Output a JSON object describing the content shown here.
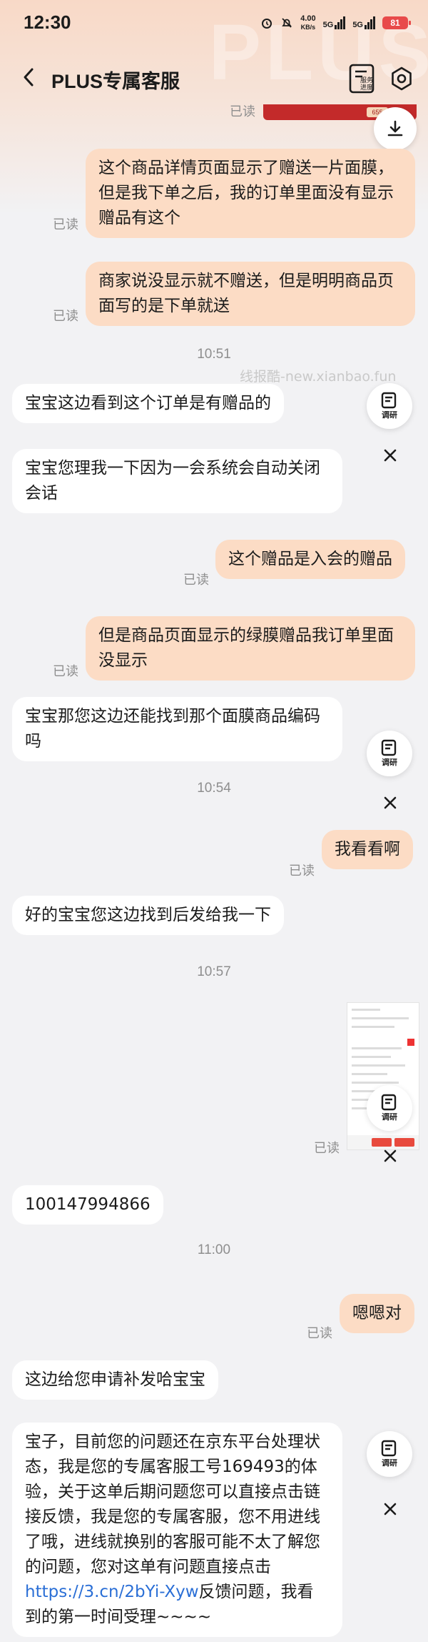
{
  "status_bar": {
    "time": "12:30",
    "net_speed": "4.00",
    "net_unit": "KB/s",
    "sig1": "5G",
    "sig2": "5G",
    "battery": "81"
  },
  "header": {
    "title": "PLUS专属客服",
    "service_label": "服务进度",
    "watermark": "PLUS"
  },
  "preview_chip": "655",
  "read_label": "已读",
  "survey_label": "调研",
  "site_watermark": "线报酷-new.xianbao.fun",
  "timestamps": [
    "10:51",
    "10:54",
    "10:57",
    "11:00"
  ],
  "messages": [
    {
      "side": "right",
      "text": "这个商品详情页面显示了赠送一片面膜，但是我下单之后，我的订单里面没有显示赠品有这个"
    },
    {
      "side": "right",
      "text": "商家说没显示就不赠送，但是明明商品页面写的是下单就送"
    },
    {
      "side": "left",
      "text": "宝宝这边看到这个订单是有赠品的"
    },
    {
      "side": "left",
      "text": "宝宝您理我一下因为一会系统会自动关闭会话"
    },
    {
      "side": "right",
      "text": "这个赠品是入会的赠品"
    },
    {
      "side": "right",
      "text": "但是商品页面显示的绿膜赠品我订单里面没显示"
    },
    {
      "side": "left",
      "text": "宝宝那您这边还能找到那个面膜商品编码吗"
    },
    {
      "side": "right",
      "text": "我看看啊"
    },
    {
      "side": "left",
      "text": "好的宝宝您这边找到后发给我一下"
    },
    {
      "side": "left",
      "text": "100147994866"
    },
    {
      "side": "right",
      "text": "嗯嗯对"
    },
    {
      "side": "left",
      "text": "这边给您申请补发哈宝宝"
    },
    {
      "side": "left",
      "text_before_link": "宝子，目前您的问题还在京东平台处理状态，我是您的专属客服工号169493的体验，关于这单后期问题您可以直接点击链接反馈，我是您的专属客服，您不用进线了哦，进线就换别的客服可能不太了解您的问题，您对这单有问题直接点击 ",
      "link": "https://3.cn/2bYi-Xyw",
      "text_after_link": "反馈问题，我看到的第一时间受理~~~~"
    }
  ],
  "colors": {
    "my_bubble": "#fcdcc5",
    "their_bubble": "#ffffff",
    "link": "#2b6fd6",
    "battery": "#e84a4a"
  }
}
